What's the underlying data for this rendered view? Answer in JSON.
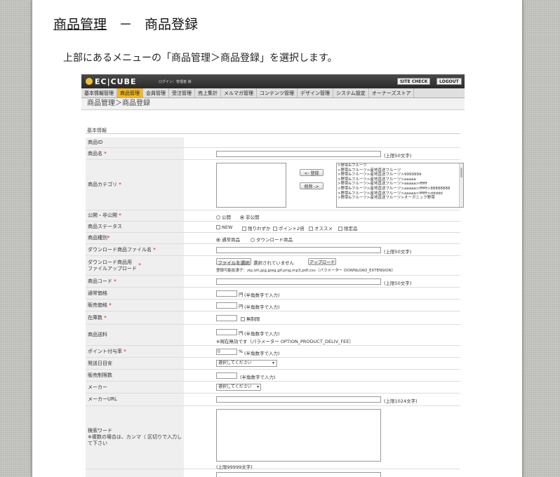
{
  "heading": {
    "left": "商品管理",
    "dash": "－",
    "right": "商品登録"
  },
  "intro": "上部にあるメニューの「商品管理＞商品登録」を選択します。",
  "app": {
    "logo": "EC|CUBE",
    "login_text": "ログイン：管理者 様",
    "site_check": "SITE CHECK",
    "logout": "LOGOUT",
    "menu": [
      "基本情報管理",
      "商品管理",
      "会員管理",
      "受注管理",
      "売上集計",
      "メルマガ管理",
      "コンテンツ管理",
      "デザイン管理",
      "システム設定",
      "オーナーズストア"
    ],
    "active_menu": "商品管理",
    "breadcrumb": "商品管理＞商品登録",
    "section_title": "基本情報",
    "required_mark": "*",
    "rows": {
      "id": "商品ID",
      "name": "商品名",
      "name_note": "(上限50文字)",
      "category": "商品カテゴリ",
      "register_btn": "<- 登録",
      "delete_btn": "削除 ->",
      "categories": [
        ">野菜&フルーツ",
        ">野菜&フルーツ>産地直送フルーツ",
        ">野菜&フルーツ>産地直送フルーツ>9999999",
        ">野菜&フルーツ>産地直送フルーツ>aaaaa",
        ">野菜&フルーツ>産地直送フルーツ>aaaaa>ffffff",
        ">野菜&フルーツ>産地直送フルーツ>aaaaa>ffffff>88888888",
        ">野菜&フルーツ>産地直送フルーツ>aaaaa>ffffff>ddddd",
        ">野菜&フルーツ>産地直送フルーツ>オーガニック野菜"
      ],
      "status_pub": "公開・非公開",
      "pub_open": "公開",
      "pub_closed": "非公開",
      "product_status": "商品ステータス",
      "status_opts": [
        "NEW",
        "残りわずか",
        "ポイント2倍",
        "オススメ",
        "限定品"
      ],
      "product_type": "商品種別",
      "type_normal": "通常商品",
      "type_download": "ダウンロード商品",
      "download_name": "ダウンロード商品ファイル名",
      "download_name_note": "(上限50文字)",
      "download_upload": "ダウンロード商品用\nファイルアップロード",
      "choose_file": "ファイルを選択",
      "no_file": "選択されていません",
      "upload_btn": "アップロード",
      "ext_note": "登録可能拡張子：zip,lzh,jpg,jpeg,gif,png,mp3,pdf,csv（パラメーター DOWNLOAD_EXTENSION）",
      "product_code": "商品コード",
      "product_code_note": "(上限50文字)",
      "list_price": "通常価格",
      "sale_price": "販売価格",
      "yen": "円",
      "num_note": "(半角数字で入力)",
      "stock": "在庫数",
      "unlimited": "無制限",
      "shipping": "商品送料",
      "shipping_note2": "※現在無効です（パラメーター OPTION_PRODUCT_DELIV_FEE）",
      "point_rate": "ポイント付与率",
      "point_value": "0",
      "percent": "%",
      "ship_date": "発送日目安",
      "select_placeholder": "選択してください",
      "sale_limit": "販売制限数",
      "maker": "メーカー",
      "maker_url": "メーカーURL",
      "maker_url_note": "(上限1024文字)",
      "keywords": "検索ワード\n※複数の場合は、カンマ（ 区切りで入力して下さい",
      "keywords_note": "(上限99999文字)"
    }
  }
}
